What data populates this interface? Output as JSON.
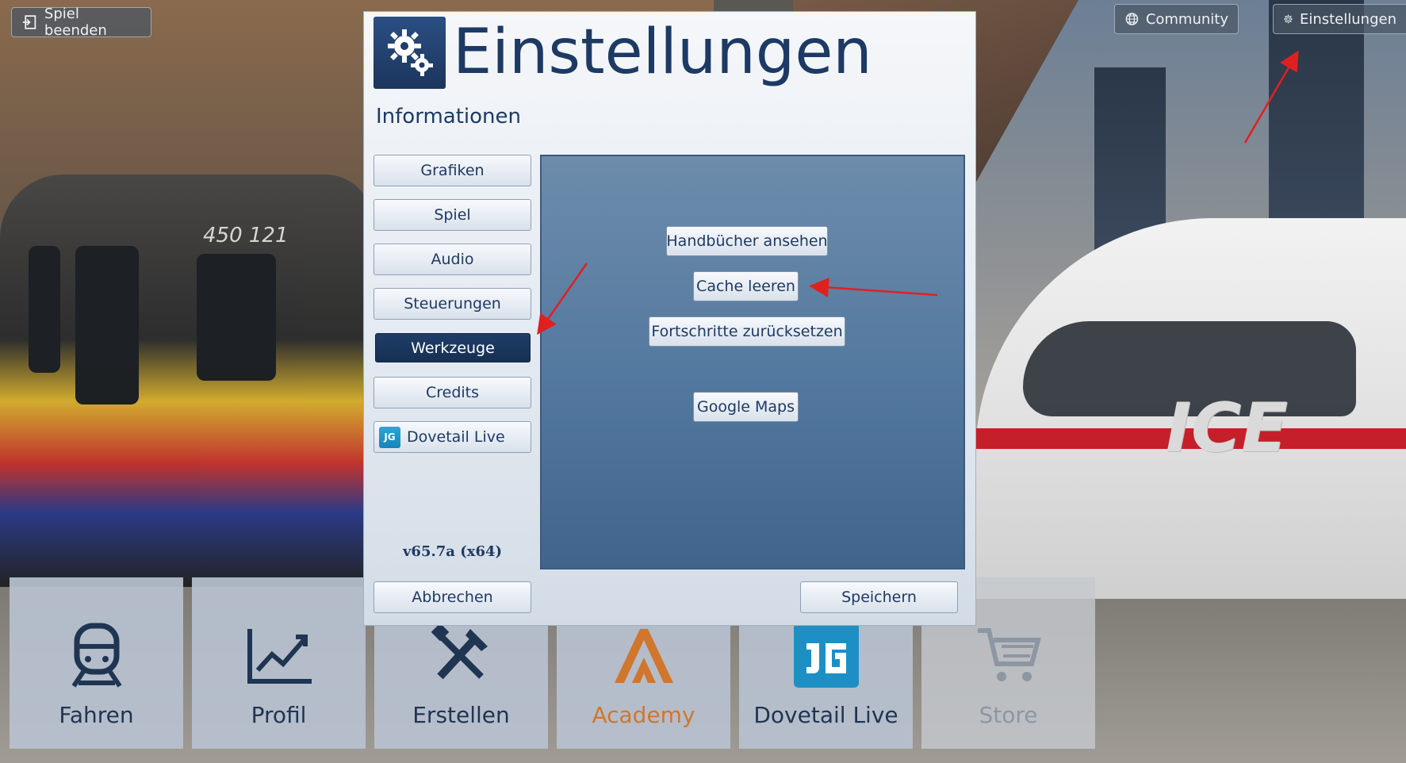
{
  "top_bar": {
    "quit_label": "Spiel beenden",
    "community_label": "Community",
    "settings_label": "Einstellungen"
  },
  "background": {
    "train_left_number": "450 121",
    "train_right_logo": "ICE"
  },
  "dialog": {
    "title": "Einstellungen",
    "subtitle": "Informationen",
    "nav_items": [
      {
        "label": "Grafiken",
        "active": false
      },
      {
        "label": "Spiel",
        "active": false
      },
      {
        "label": "Audio",
        "active": false
      },
      {
        "label": "Steuerungen",
        "active": false
      },
      {
        "label": "Werkzeuge",
        "active": true
      },
      {
        "label": "Credits",
        "active": false
      },
      {
        "label": "Dovetail Live",
        "active": false,
        "icon": "dovetail-live-icon"
      }
    ],
    "version": "v65.7a (x64)",
    "tools": {
      "manuals_label": "Handbücher ansehen",
      "clear_cache_label": "Cache leeren",
      "reset_progress_label": "Fortschritte zurücksetzen",
      "google_maps_label": "Google Maps"
    },
    "cancel_label": "Abbrechen",
    "save_label": "Speichern"
  },
  "main_menu": {
    "tiles": [
      {
        "label": "Fahren",
        "icon": "train-icon"
      },
      {
        "label": "Profil",
        "icon": "chart-icon"
      },
      {
        "label": "Erstellen",
        "icon": "tools-icon"
      },
      {
        "label": "Academy",
        "icon": "academy-icon"
      },
      {
        "label": "Dovetail Live",
        "icon": "dovetail-live-icon"
      },
      {
        "label": "Store",
        "icon": "cart-icon"
      }
    ]
  },
  "colors": {
    "dialog_navy": "#1d3a64",
    "active_nav": "#1f3d68",
    "academy_orange": "#d0762d",
    "annotation_red": "#e02020"
  }
}
